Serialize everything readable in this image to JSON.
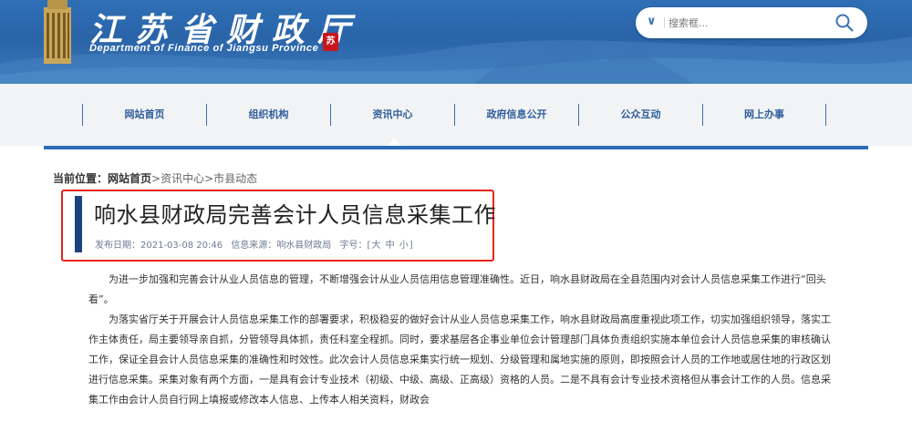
{
  "header": {
    "title": "江苏省财政厅",
    "subtitle": "Department of Finance of Jiangsu Province",
    "seal_text": "苏",
    "brand_color": "#2a64a8"
  },
  "search": {
    "placeholder": "搜索框..."
  },
  "nav": {
    "items": [
      {
        "label": "网站首页"
      },
      {
        "label": "组织机构"
      },
      {
        "label": "资讯中心"
      },
      {
        "label": "政府信息公开"
      },
      {
        "label": "公众互动"
      },
      {
        "label": "网上办事"
      }
    ],
    "active_index": 2
  },
  "breadcrumb": {
    "prefix": "当前位置：",
    "home": "网站首页",
    "sep1": ">",
    "level2": "资讯中心",
    "sep2": ">",
    "level3": "市县动态"
  },
  "article": {
    "title": "响水县财政局完善会计人员信息采集工作",
    "date_label": "发布日期：",
    "date": "2021-03-08  20:46",
    "source_label": "信息来源：",
    "source": "响水县财政局",
    "fontsize_label": "字号：[",
    "fs_large": "大",
    "fs_medium": "中",
    "fs_small": "小",
    "fontsize_close": "]",
    "highlight_color": "#e8241b",
    "paragraphs": [
      "为进一步加强和完善会计从业人员信息的管理，不断增强会计从业人员信用信息管理准确性。近日，响水县财政局在全县范围内对会计人员信息采集工作进行“回头看”。",
      "为落实省厅关于开展会计人员信息采集工作的部署要求，积极稳妥的做好会计从业人员信息采集工作，响水县财政局高度重视此项工作，切实加强组织领导，落实工作主体责任，局主要领导亲自抓，分管领导具体抓，责任科室全程抓。同时，要求基层各企事业单位会计管理部门具体负责组织实施本单位会计人员信息采集的审核确认工作，保证全县会计人员信息采集的准确性和时效性。此次会计人员信息采集实行统一规划、分级管理和属地实施的原则，即按照会计人员的工作地或居住地的行政区划进行信息采集。采集对象有两个方面，一是具有会计专业技术（初级、中级、高级、正高级）资格的人员。二是不具有会计专业技术资格但从事会计工作的人员。信息采集工作由会计人员自行网上填报或修改本人信息、上传本人相关资料，财政会"
    ]
  }
}
